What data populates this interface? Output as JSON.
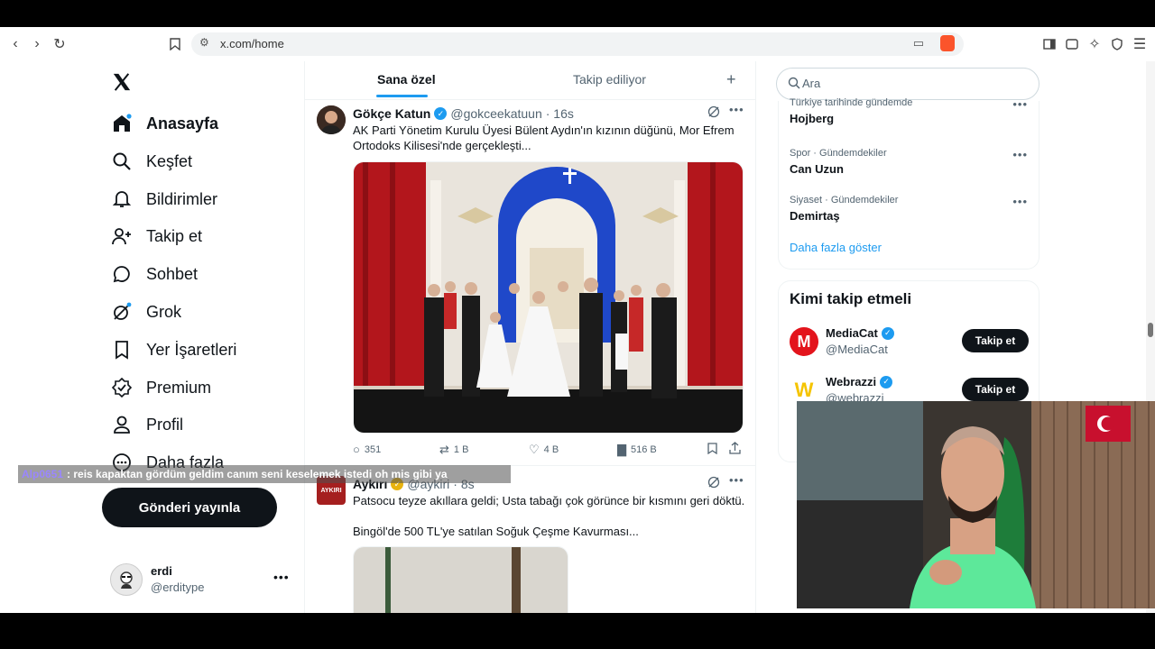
{
  "browser": {
    "url": "x.com/home"
  },
  "nav": {
    "items": [
      {
        "label": "Anasayfa",
        "icon": "home-icon"
      },
      {
        "label": "Keşfet",
        "icon": "search-icon"
      },
      {
        "label": "Bildirimler",
        "icon": "bell-icon"
      },
      {
        "label": "Takip et",
        "icon": "person-add-icon"
      },
      {
        "label": "Sohbet",
        "icon": "chat-icon"
      },
      {
        "label": "Grok",
        "icon": "grok-icon"
      },
      {
        "label": "Yer İşaretleri",
        "icon": "bookmark-icon"
      },
      {
        "label": "Premium",
        "icon": "verified-icon"
      },
      {
        "label": "Profil",
        "icon": "profile-icon"
      },
      {
        "label": "Daha fazla",
        "icon": "more-icon"
      }
    ],
    "post_button": "Gönderi yayınla"
  },
  "account": {
    "name": "erdi",
    "handle": "@erditype"
  },
  "tabs": [
    "Sana özel",
    "Takip ediliyor"
  ],
  "tweets": [
    {
      "name": "Gökçe Katun",
      "handle": "@gokceekatuun",
      "time": "· 16s",
      "text_line1": "AK Parti Yönetim Kurulu Üyesi Bülent Aydın'ın kızının düğünü, Mor Efrem",
      "text_line2": "Ortodoks Kilisesi'nde gerçekleşti...",
      "replies": "351",
      "reposts": "1 B",
      "likes": "4 B",
      "views": "516 B"
    },
    {
      "name": "Aykırı",
      "handle": "@aykiri",
      "time": "· 8s",
      "avatar_text": "AYKIRI",
      "text_line1": "Patsocu teyze akıllara geldi; Usta tabağı çok görünce bir kısmını geri döktü.",
      "text_line2": "Bingöl'de 500 TL'ye satılan Soğuk Çeşme Kavurması..."
    }
  ],
  "search": {
    "placeholder": "Ara"
  },
  "trends": [
    {
      "context": "Türkiye tarihinde gündemde",
      "name": "Hojberg"
    },
    {
      "context": "Spor · Gündemdekiler",
      "name": "Can Uzun"
    },
    {
      "context": "Siyaset · Gündemdekiler",
      "name": "Demirtaş"
    }
  ],
  "show_more": "Daha fazla göster",
  "who_to_follow": {
    "title": "Kimi takip etmeli",
    "accounts": [
      {
        "name": "MediaCat",
        "handle": "@MediaCat",
        "button": "Takip et",
        "logo": "M",
        "color": "#e3141c"
      },
      {
        "name": "Webrazzi",
        "handle": "@webrazzi",
        "button": "Takip et",
        "logo": "W",
        "color": "#f5c400"
      }
    ]
  },
  "chat": {
    "user": "Alp0651",
    "message": ": reis kapaktan gördüm geldim canım seni keselemek istedi oh mis gibi ya"
  },
  "colors": {
    "accent": "#1d9bf0",
    "text": "#0f1419",
    "muted": "#536471"
  }
}
